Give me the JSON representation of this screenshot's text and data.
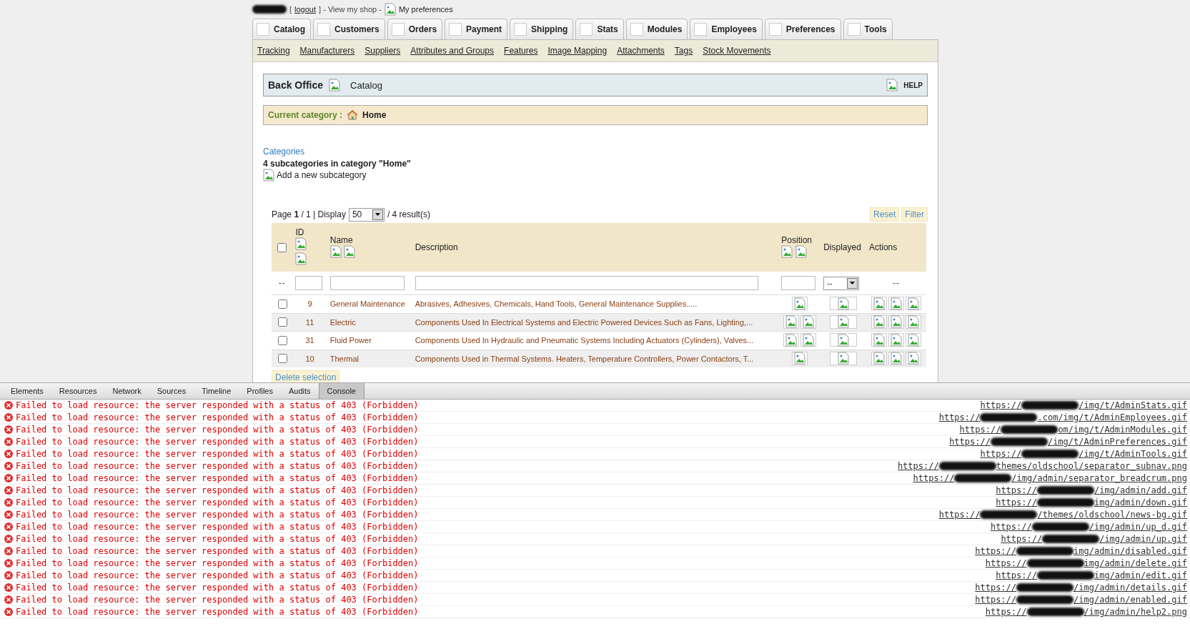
{
  "header": {
    "bracket": "[",
    "logout": "logout",
    "after": "] - View my shop -",
    "preferences": "My preferences"
  },
  "tabs": [
    {
      "label": "Catalog"
    },
    {
      "label": "Customers"
    },
    {
      "label": "Orders"
    },
    {
      "label": "Payment"
    },
    {
      "label": "Shipping"
    },
    {
      "label": "Stats"
    },
    {
      "label": "Modules"
    },
    {
      "label": "Employees"
    },
    {
      "label": "Preferences"
    },
    {
      "label": "Tools"
    }
  ],
  "subtabs": [
    "Tracking",
    "Manufacturers",
    "Suppliers",
    "Attributes and Groups",
    "Features",
    "Image Mapping",
    "Attachments",
    "Tags",
    "Stock Movements"
  ],
  "title_bar": {
    "title": "Back Office",
    "section": "Catalog",
    "help": "HELP"
  },
  "breadcrumb": {
    "label": "Current category :",
    "current": "Home"
  },
  "categories": {
    "heading": "Categories",
    "summary": "4 subcategories in category \"Home\"",
    "add": "Add a new subcategory"
  },
  "pagination": {
    "page_label": "Page",
    "page": "1",
    "after_page": "/ 1 | Display",
    "display": "50",
    "results": "/ 4 result(s)"
  },
  "filter_buttons": [
    "Reset",
    "Filter"
  ],
  "table": {
    "columns": [
      "ID",
      "Name",
      "Description",
      "Position",
      "Displayed",
      "Actions"
    ],
    "select_all_checked": false,
    "filter_row": {
      "checkbox_cell": "--",
      "displayed_select": "--",
      "actions_cell": "--"
    },
    "rows": [
      {
        "checked": false,
        "id": "9",
        "name": "General Maintenance",
        "description": "Abrasives, Adhesives, Chemicals, Hand Tools, General Maintenance Supplies.....",
        "position_buttons": [
          {
            "kind": "move"
          }
        ]
      },
      {
        "checked": false,
        "id": "11",
        "name": "Electric",
        "description": "Components Used In Electrical Systems and Electric Powered Devices Such as Fans, Lighting,...",
        "position_buttons": [
          {
            "kind": "move"
          },
          {
            "kind": "move"
          }
        ]
      },
      {
        "checked": false,
        "id": "31",
        "name": "Fluid Power",
        "description": "Components Used In Hydraulic and Pneumatic Systems Including Actuators (Cylinders), Valves...",
        "position_buttons": [
          {
            "kind": "move"
          },
          {
            "kind": "move"
          }
        ]
      },
      {
        "checked": false,
        "id": "10",
        "name": "Thermal",
        "description": "Components Used in Thermal Systems. Heaters, Temperature Controllers, Power Contactors, T...",
        "position_buttons": [
          {
            "kind": "move"
          }
        ]
      }
    ]
  },
  "delete_button": "Delete selection",
  "devtools": {
    "tabs": [
      {
        "label": "Elements",
        "selected": false
      },
      {
        "label": "Resources",
        "selected": false
      },
      {
        "label": "Network",
        "selected": false
      },
      {
        "label": "Sources",
        "selected": false
      },
      {
        "label": "Timeline",
        "selected": false
      },
      {
        "label": "Profiles",
        "selected": false
      },
      {
        "label": "Audits",
        "selected": false
      },
      {
        "label": "Console",
        "selected": true
      }
    ],
    "messages": [
      {
        "text": "Failed to load resource: the server responded with a status of 403 (Forbidden)",
        "url_start": "https://",
        "url_end": "/img/t/AdminStats.gif"
      },
      {
        "text": "Failed to load resource: the server responded with a status of 403 (Forbidden)",
        "url_start": "https://",
        "url_end": ".com/img/t/AdminEmployees.gif"
      },
      {
        "text": "Failed to load resource: the server responded with a status of 403 (Forbidden)",
        "url_start": "https://",
        "url_end": "om/img/t/AdminModules.gif"
      },
      {
        "text": "Failed to load resource: the server responded with a status of 403 (Forbidden)",
        "url_start": "https://",
        "url_end": "/img/t/AdminPreferences.gif"
      },
      {
        "text": "Failed to load resource: the server responded with a status of 403 (Forbidden)",
        "url_start": "https://",
        "url_end": "/img/t/AdminTools.gif"
      },
      {
        "text": "Failed to load resource: the server responded with a status of 403 (Forbidden)",
        "url_start": "https://",
        "url_end": "themes/oldschool/separator_subnav.png"
      },
      {
        "text": "Failed to load resource: the server responded with a status of 403 (Forbidden)",
        "url_start": "https://",
        "url_end": "/img/admin/separator_breadcrum.png"
      },
      {
        "text": "Failed to load resource: the server responded with a status of 403 (Forbidden)",
        "url_start": "https://",
        "url_end": "/img/admin/add.gif"
      },
      {
        "text": "Failed to load resource: the server responded with a status of 403 (Forbidden)",
        "url_start": "https://",
        "url_end": "img/admin/down.gif"
      },
      {
        "text": "Failed to load resource: the server responded with a status of 403 (Forbidden)",
        "url_start": "https://",
        "url_end": "/themes/oldschool/news-bg.gif"
      },
      {
        "text": "Failed to load resource: the server responded with a status of 403 (Forbidden)",
        "url_start": "https://",
        "url_end": "/img/admin/up_d.gif"
      },
      {
        "text": "Failed to load resource: the server responded with a status of 403 (Forbidden)",
        "url_start": "https://",
        "url_end": "/img/admin/up.gif"
      },
      {
        "text": "Failed to load resource: the server responded with a status of 403 (Forbidden)",
        "url_start": "https://",
        "url_end": "img/admin/disabled.gif"
      },
      {
        "text": "Failed to load resource: the server responded with a status of 403 (Forbidden)",
        "url_start": "https://",
        "url_end": "img/admin/delete.gif"
      },
      {
        "text": "Failed to load resource: the server responded with a status of 403 (Forbidden)",
        "url_start": "https://",
        "url_end": "img/admin/edit.gif"
      },
      {
        "text": "Failed to load resource: the server responded with a status of 403 (Forbidden)",
        "url_start": "https://",
        "url_end": "/img/admin/details.gif"
      },
      {
        "text": "Failed to load resource: the server responded with a status of 403 (Forbidden)",
        "url_start": "https://",
        "url_end": "/img/admin/enabled.gif"
      },
      {
        "text": "Failed to load resource: the server responded with a status of 403 (Forbidden)",
        "url_start": "https://",
        "url_end": "/img/admin/help2.png"
      }
    ]
  }
}
